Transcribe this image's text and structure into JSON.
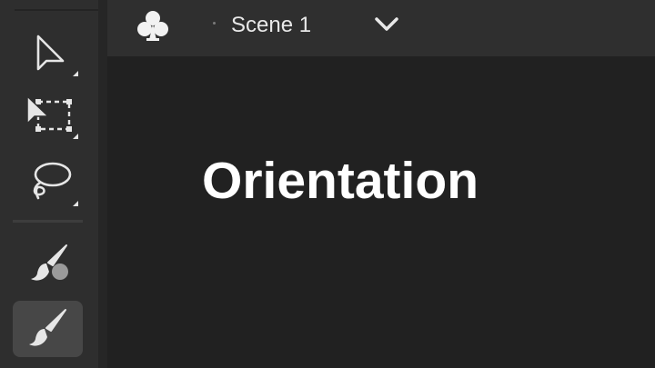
{
  "scene_bar": {
    "scene_icon": "club-icon",
    "scene_name": "Scene 1",
    "dropdown_icon": "chevron-down-icon"
  },
  "toolbar": {
    "tools": [
      {
        "name": "selection-tool",
        "icon": "arrow-cursor-icon",
        "active": false
      },
      {
        "name": "free-transform-tool",
        "icon": "free-transform-icon",
        "active": false
      },
      {
        "name": "lasso-tool",
        "icon": "lasso-icon",
        "active": false
      },
      {
        "name": "paint-brush-tool",
        "icon": "paint-brush-icon",
        "active": false
      },
      {
        "name": "brush-tool",
        "icon": "brush-icon",
        "active": true
      }
    ]
  },
  "stage": {
    "title": "Orientation"
  },
  "colors": {
    "stage_bg": "#212121",
    "toolbar_bg": "#2e2e2e",
    "scene_bar_bg": "#2f2f2f",
    "active_tool_bg": "#474747",
    "icon_color": "#e6e6e6",
    "title_color": "#ffffff"
  }
}
